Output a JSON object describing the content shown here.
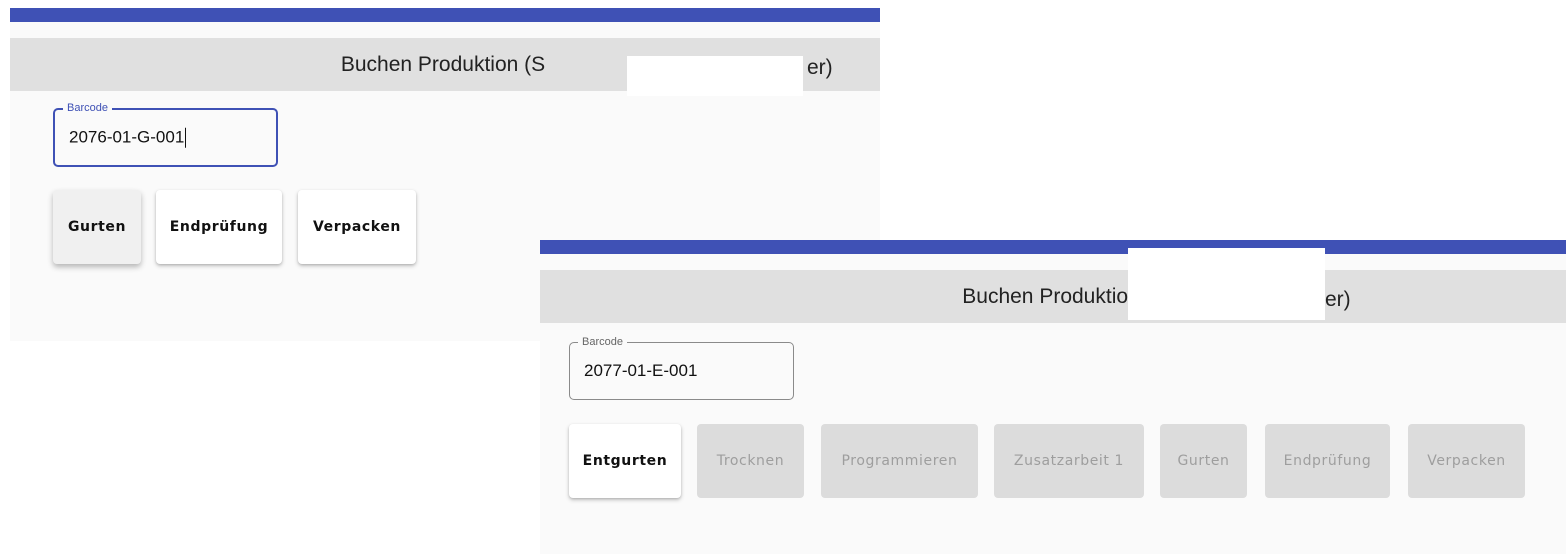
{
  "screen1": {
    "header_title": "Buchen Produktion (S",
    "header_tail": "er)",
    "barcode": {
      "label": "Barcode",
      "value": "2076-01-G-001"
    },
    "buttons": [
      "Gurten",
      "Endprüfung",
      "Verpacken"
    ]
  },
  "screen2": {
    "header_title": "Buchen Produktion",
    "header_tail": "er)",
    "barcode": {
      "label": "Barcode",
      "value": "2077-01-E-001"
    },
    "buttons": [
      "Entgurten",
      "Trocknen",
      "Programmieren",
      "Zusatzarbeit 1",
      "Gurten",
      "Endprüfung",
      "Verpacken"
    ]
  },
  "colors": {
    "accent": "#3f51b5",
    "header_bg": "#e0e0e0",
    "panel_bg": "#fafafa",
    "disabled_bg": "#dcdcdc"
  }
}
